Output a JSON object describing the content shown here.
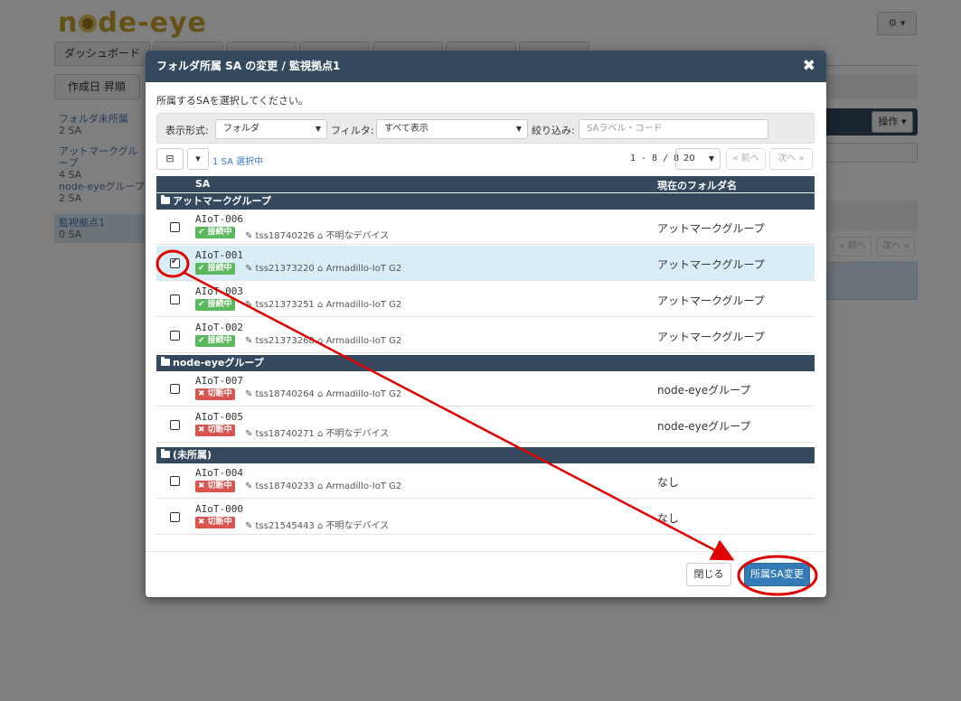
{
  "app": {
    "logo": "node-eye",
    "logo_prefix": "n",
    "logo_suffix": "de-eye",
    "settings_button": "⚙ ▾",
    "tabs": [
      "ダッシュボード"
    ],
    "sort_button": "作成日 昇順",
    "sidebar": [
      {
        "name": "フォルダ未所属",
        "count": "2 SA"
      },
      {
        "name": "アットマークグループ",
        "count": "4 SA"
      },
      {
        "name": "node-eyeグループ",
        "count": "2 SA"
      },
      {
        "name": "監視拠点1",
        "count": "0 SA"
      }
    ],
    "operations_button": "操作 ▾",
    "prev_page": "« 前へ",
    "next_page": "次へ »"
  },
  "modal": {
    "title": "フォルダ所属 SA の変更 / 監視拠点1",
    "close_icon": "✖",
    "instruction": "所属するSAを選択してください。",
    "filters": {
      "display_label": "表示形式:",
      "display_value": "フォルダ",
      "filter_label": "フィルタ:",
      "filter_value": "すべて表示",
      "search_label": "絞り込み:",
      "search_placeholder": "SAラベル・コード"
    },
    "toolbar": {
      "collapse_icon": "⊟",
      "dropdown_caret": "▾",
      "selected_count": "1 SA 選択中",
      "range": "1 - 8 / 8",
      "page_size": "20",
      "prev": "« 前へ",
      "next": "次へ »"
    },
    "columns": {
      "sa": "SA",
      "folder": "現在のフォルダ名"
    },
    "groups": [
      {
        "name": "アットマークグループ",
        "rows": [
          {
            "checked": false,
            "name": "AIoT-006",
            "status": "✔ 接続中",
            "status_type": "online",
            "serial": "✎ tss18740226",
            "device": "⌂ 不明なデバイス",
            "folder": "アットマークグループ"
          },
          {
            "checked": true,
            "name": "AIoT-001",
            "status": "✔ 接続中",
            "status_type": "online",
            "serial": "✎ tss21373220",
            "device": "⌂ Armadillo-IoT G2",
            "folder": "アットマークグループ"
          },
          {
            "checked": false,
            "name": "AIoT-003",
            "status": "✔ 接続中",
            "status_type": "online",
            "serial": "✎ tss21373251",
            "device": "⌂ Armadillo-IoT G2",
            "folder": "アットマークグループ"
          },
          {
            "checked": false,
            "name": "AIoT-002",
            "status": "✔ 接続中",
            "status_type": "online",
            "serial": "✎ tss21373268",
            "device": "⌂ Armadillo-IoT G2",
            "folder": "アットマークグループ"
          }
        ]
      },
      {
        "name": "node-eyeグループ",
        "rows": [
          {
            "checked": false,
            "name": "AIoT-007",
            "status": "✖ 切断中",
            "status_type": "offline",
            "serial": "✎ tss18740264",
            "device": "⌂ Armadillo-IoT G2",
            "folder": "node-eyeグループ"
          },
          {
            "checked": false,
            "name": "AIoT-005",
            "status": "✖ 切断中",
            "status_type": "offline",
            "serial": "✎ tss18740271",
            "device": "⌂ 不明なデバイス",
            "folder": "node-eyeグループ"
          }
        ]
      },
      {
        "name": "(未所属)",
        "rows": [
          {
            "checked": false,
            "name": "AIoT-004",
            "status": "✖ 切断中",
            "status_type": "offline",
            "serial": "✎ tss18740233",
            "device": "⌂ Armadillo-IoT G2",
            "folder": "なし"
          },
          {
            "checked": false,
            "name": "AIoT-000",
            "status": "✖ 切断中",
            "status_type": "offline",
            "serial": "✎ tss21545443",
            "device": "⌂ 不明なデバイス",
            "folder": "なし"
          }
        ]
      }
    ],
    "footer": {
      "close": "閉じる",
      "submit": "所属SA変更"
    }
  },
  "colors": {
    "header_bg": "#34495e",
    "online": "#5cb85c",
    "offline": "#d9534f",
    "primary": "#337ab7",
    "annotation": "#e00000",
    "logo": "#caa12d"
  }
}
